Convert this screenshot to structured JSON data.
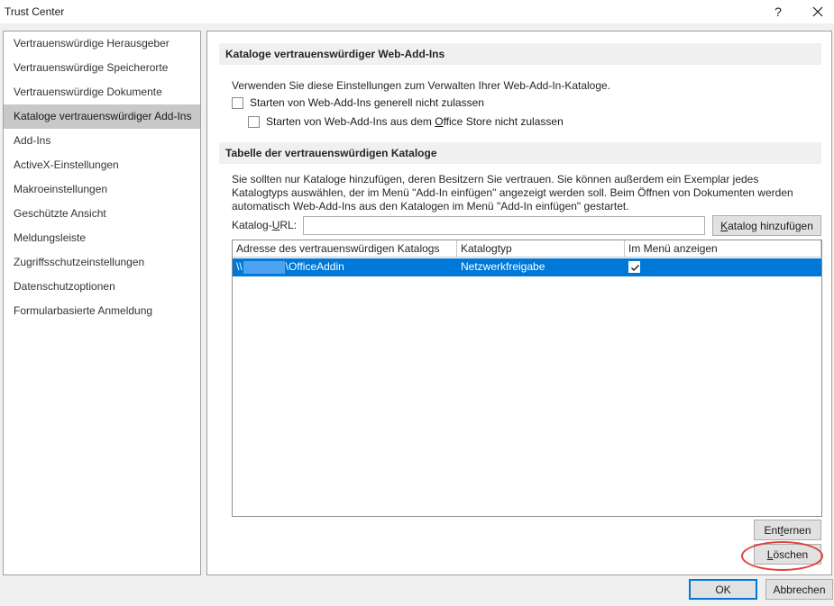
{
  "window": {
    "title": "Trust Center",
    "help_label": "?",
    "close_icon": "close-icon"
  },
  "sidebar": {
    "items": [
      {
        "label": "Vertrauenswürdige Herausgeber"
      },
      {
        "label": "Vertrauenswürdige Speicherorte"
      },
      {
        "label": "Vertrauenswürdige Dokumente"
      },
      {
        "label": "Kataloge vertrauenswürdiger Add-Ins"
      },
      {
        "label": "Add-Ins"
      },
      {
        "label": "ActiveX-Einstellungen"
      },
      {
        "label": "Makroeinstellungen"
      },
      {
        "label": "Geschützte Ansicht"
      },
      {
        "label": "Meldungsleiste"
      },
      {
        "label": "Zugriffsschutzeinstellungen"
      },
      {
        "label": "Datenschutzoptionen"
      },
      {
        "label": "Formularbasierte Anmeldung"
      }
    ],
    "selected": "Kataloge vertrauenswürdiger Add-Ins"
  },
  "web_addins": {
    "header": "Kataloge vertrauenswürdiger Web-Add-Ins",
    "description": "Verwenden Sie diese Einstellungen zum Verwalten Ihrer Web-Add-In-Kataloge.",
    "cb1_label": "Starten von Web-Add-Ins generell nicht zulassen",
    "cb1_checked": false,
    "cb2_label_pre": "Starten von Web-Add-Ins aus dem ",
    "cb2_label_u": "O",
    "cb2_label_post": "ffice Store nicht zulassen",
    "cb2_checked": false
  },
  "catalogs": {
    "header": "Tabelle der vertrauenswürdigen Kataloge",
    "description": "Sie sollten nur Kataloge hinzufügen, deren Besitzern Sie vertrauen. Sie können außerdem ein Exemplar jedes Katalogtyps auswählen, der im Menü \"Add-In einfügen\" angezeigt werden soll. Beim Öffnen von Dokumenten werden automatisch Web-Add-Ins aus den Katalogen im Menü \"Add-In einfügen\" gestartet.",
    "url_label_pre": "Katalog-",
    "url_label_u": "U",
    "url_label_post": "RL:",
    "url_value": "",
    "add_button_u": "K",
    "add_button_post": "atalog hinzufügen",
    "columns": [
      "Adresse des vertrauenswürdigen Katalogs",
      "Katalogtyp",
      "Im Menü anzeigen"
    ],
    "rows": [
      {
        "address_prefix": "\\\\",
        "address_suffix": "\\OfficeAddin",
        "type": "Netzwerkfreigabe",
        "show_in_menu": true
      }
    ],
    "remove_button_pre": "Ent",
    "remove_button_u": "f",
    "remove_button_post": "ernen",
    "delete_button_u": "L",
    "delete_button_post": "öschen"
  },
  "footer": {
    "ok_label": "OK",
    "cancel_label": "Abbrechen"
  },
  "colors": {
    "selection": "#0078d7",
    "sidebar_selected": "#c8c8c8",
    "highlight_ellipse": "#e0403f"
  }
}
